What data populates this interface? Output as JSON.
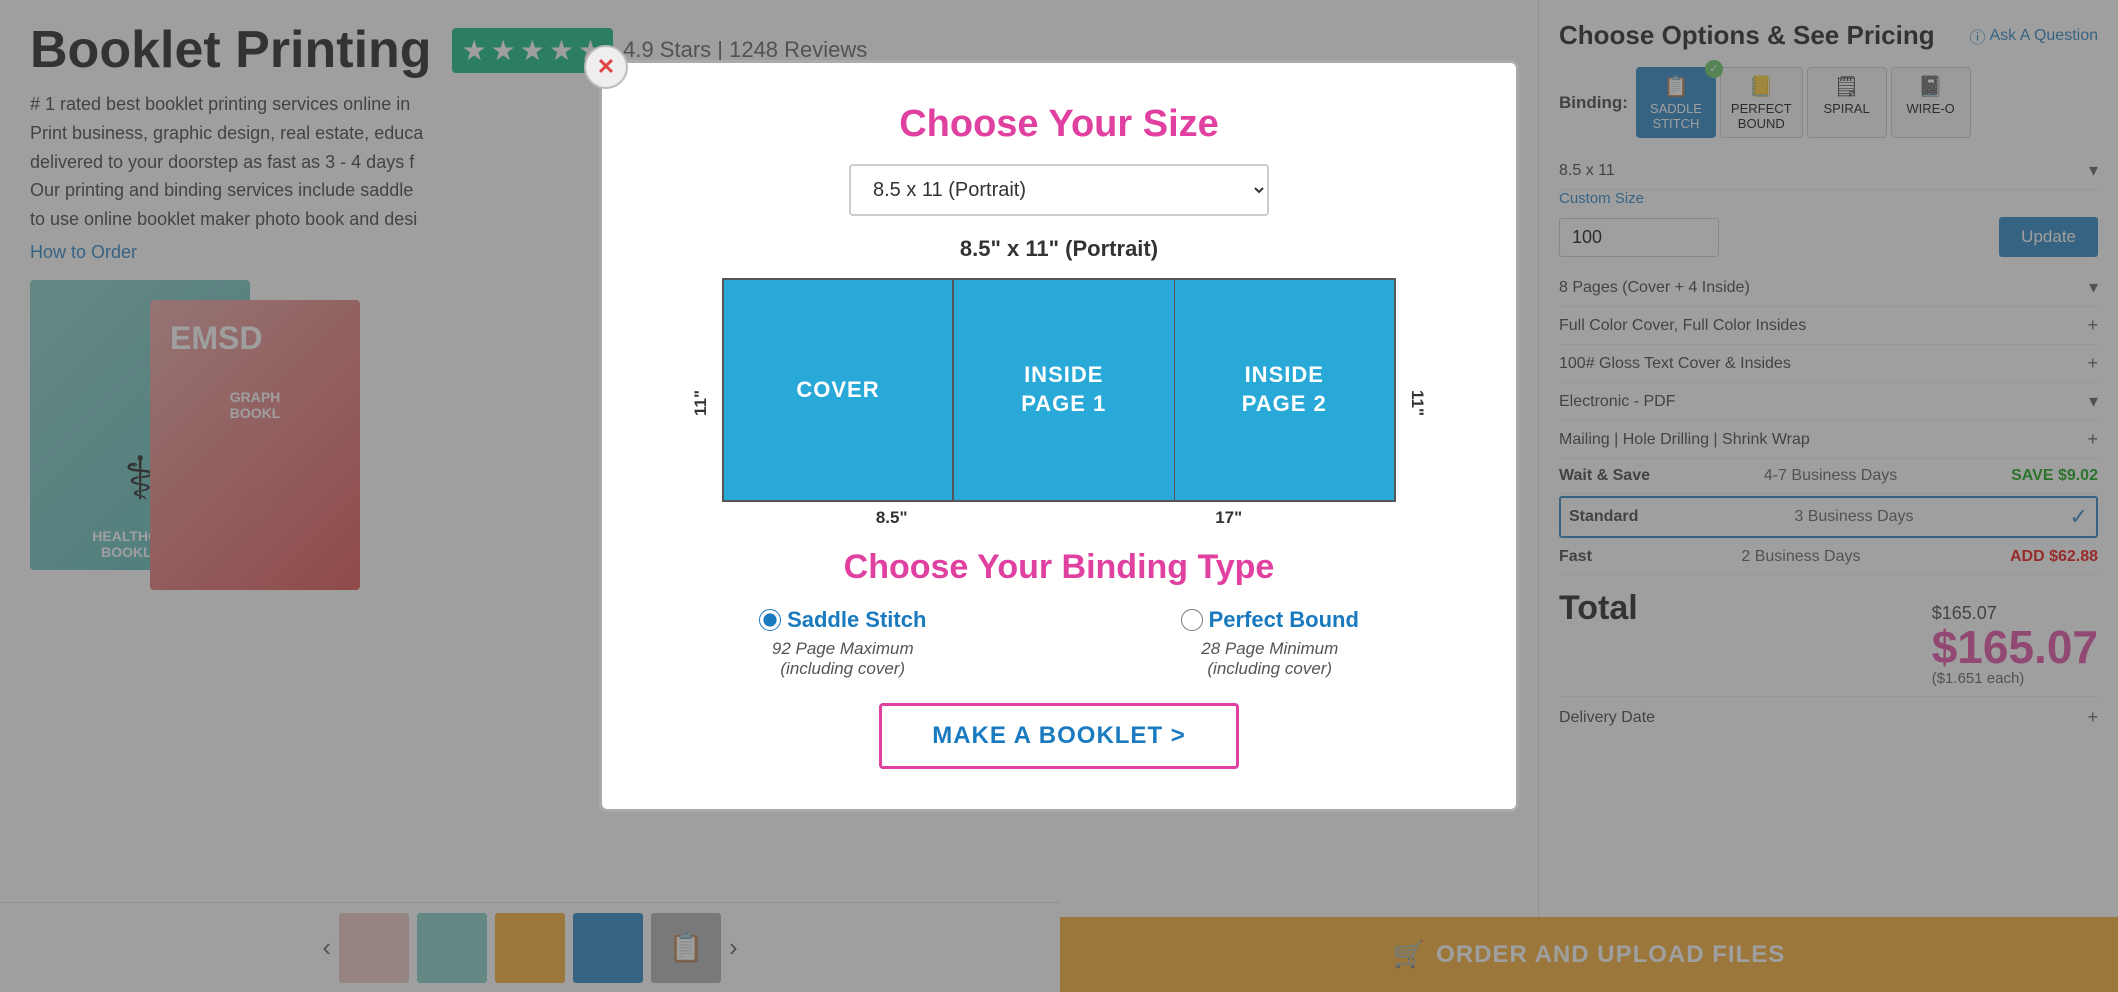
{
  "page": {
    "title": "Booklet Printing",
    "stars_count": "4.9 Stars | 1248 Reviews",
    "description_1": "# 1 rated best booklet printing services online in",
    "description_2": "Print business, graphic design, real estate, educa",
    "description_3": "delivered to your doorstep as fast as 3 - 4 days f",
    "description_4": "Our printing and binding services include saddle",
    "description_5": "to use online booklet maker photo book and desi",
    "how_to_order": "How to Order"
  },
  "modal": {
    "close_label": "✕",
    "title": "Choose Your Size",
    "size_dropdown_value": "8.5 x 11 (Portrait)",
    "size_dimension_label": "8.5\" x 11\" (Portrait)",
    "dim_top": "8.5 x 11 (Portrait)",
    "dim_width_cover": "8.5\"",
    "dim_width_inside": "17\"",
    "dim_height_left": "11\"",
    "dim_height_right": "11\"",
    "page_cover_text": "COVER",
    "page_inside1_text": "INSIDE\nPAGE 1",
    "page_inside2_text": "INSIDE\nPAGE 2",
    "binding_title": "Choose Your Binding Type",
    "saddle_stitch_label": "Saddle Stitch",
    "saddle_stitch_desc": "92 Page Maximum\n(including cover)",
    "perfect_bound_label": "Perfect Bound",
    "perfect_bound_desc": "28 Page Minimum\n(including cover)",
    "saddle_selected": true,
    "make_booklet_label": "MAKE A BOOKLET >"
  },
  "right_panel": {
    "title": "Choose Options & See Pricing",
    "ask_question": "Ask A Question",
    "binding_label": "Binding:",
    "binding_tabs": [
      {
        "id": "saddle-stitch",
        "label": "SADDLE\nSTITCH",
        "active": true
      },
      {
        "id": "perfect-bound",
        "label": "PERFECT\nBOUND",
        "active": false
      },
      {
        "id": "spiral",
        "label": "SPIRAL",
        "active": false
      },
      {
        "id": "wire-o",
        "label": "WIRE-O",
        "active": false
      }
    ],
    "size_value": "8.5 x 11",
    "custom_size_label": "Custom Size",
    "quantity_value": "100",
    "update_label": "Update",
    "pages_label": "8 Pages (Cover + 4 Inside)",
    "color_label": "Full Color Cover, Full Color Insides",
    "paper_label": "100# Gloss Text Cover & Insides",
    "delivery_type_label": "Electronic - PDF",
    "mailing_label": "Mailing | Hole Drilling | Shrink Wrap",
    "turnaround_rows": [
      {
        "label": "Wait & Save",
        "days": "4-7 Business Days",
        "price": "SAVE $9.02",
        "type": "save",
        "selected": false
      },
      {
        "label": "Standard",
        "days": "3 Business Days",
        "price": "",
        "type": "selected",
        "selected": true
      },
      {
        "label": "Fast",
        "days": "2 Business Days",
        "price": "ADD $62.88",
        "type": "add",
        "selected": false
      }
    ],
    "total_small": "$165.07",
    "total_label": "Total",
    "total_big": "$165.07",
    "total_each": "($1.651 each)",
    "delivery_label": "Delivery Date",
    "order_btn_label": "ORDER AND UPLOAD FILES"
  },
  "thumbnails": {
    "prev": "‹",
    "next": "›"
  }
}
